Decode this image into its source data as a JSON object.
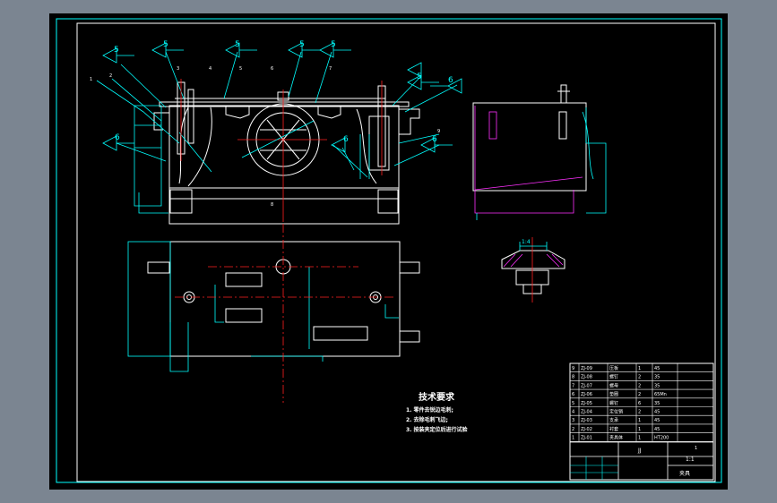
{
  "colors": {
    "outer": "#7b8591",
    "sheet": "#000000",
    "line": "#ffffff",
    "cyan": "#00ffff",
    "red": "#ff2020",
    "magenta": "#ff30ff",
    "green": "#30ff30"
  },
  "callouts": {
    "c1": "5",
    "c2": "5",
    "c3": "5",
    "c4": "5",
    "c5": "5",
    "c6": "5",
    "c7": "6",
    "c8": "6",
    "c9": "6",
    "c10": "6",
    "d1": "1",
    "d2": "2",
    "d3": "3",
    "d4": "4",
    "d5": "5",
    "d6": "6",
    "d7": "7",
    "d8": "8",
    "d9": "9"
  },
  "section_label": "1:4",
  "tech": {
    "title": "技术要求",
    "items": [
      "1. 零件去锐边毛刺;",
      "2. 去除毛刺飞边;",
      "3. 按装夹定位后进行试验"
    ]
  },
  "title_block": {
    "rows": [
      {
        "no": "9",
        "code": "ZJ-09",
        "name": "压板",
        "qty": "1",
        "mat": "45"
      },
      {
        "no": "8",
        "code": "ZJ-08",
        "name": "螺钉",
        "qty": "2",
        "mat": "35"
      },
      {
        "no": "7",
        "code": "ZJ-07",
        "name": "螺母",
        "qty": "2",
        "mat": "35"
      },
      {
        "no": "6",
        "code": "ZJ-06",
        "name": "垫圈",
        "qty": "2",
        "mat": "65Mn"
      },
      {
        "no": "5",
        "code": "ZJ-05",
        "name": "螺钉",
        "qty": "6",
        "mat": "35"
      },
      {
        "no": "4",
        "code": "ZJ-04",
        "name": "定位销",
        "qty": "2",
        "mat": "45"
      },
      {
        "no": "3",
        "code": "ZJ-03",
        "name": "支承",
        "qty": "1",
        "mat": "45"
      },
      {
        "no": "2",
        "code": "ZJ-02",
        "name": "衬套",
        "qty": "1",
        "mat": "45"
      },
      {
        "no": "1",
        "code": "ZJ-01",
        "name": "夹具体",
        "qty": "1",
        "mat": "HT200"
      }
    ],
    "drawing_no": "JJ",
    "scale": "1:1",
    "title": "夹具",
    "sheet": "1"
  }
}
